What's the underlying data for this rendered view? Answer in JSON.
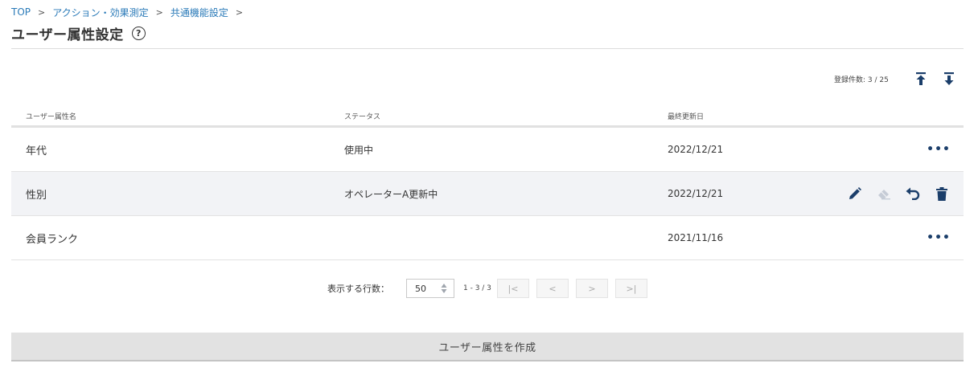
{
  "breadcrumb": [
    {
      "label": "TOP"
    },
    {
      "label": "アクション・効果測定"
    },
    {
      "label": "共通機能設定"
    }
  ],
  "breadcrumb_separator": ">",
  "page": {
    "title": "ユーザー属性設定",
    "help_icon": "?"
  },
  "summary": {
    "count_text": "登録件数: 3 / 25"
  },
  "toolbar": {
    "upload_icon": "upload-arrow-icon",
    "download_icon": "download-arrow-icon"
  },
  "table": {
    "columns": [
      "ユーザー属性名",
      "ステータス",
      "最終更新日"
    ],
    "rows": [
      {
        "name": "年代",
        "status": "使用中",
        "date": "2022/12/21",
        "more": "•••"
      },
      {
        "name": "性別",
        "status": "オペレーターA更新中",
        "date": "2022/12/21"
      },
      {
        "name": "会員ランク",
        "status": "",
        "date": "2021/11/16",
        "more": "•••"
      }
    ]
  },
  "pagination": {
    "rows_label": "表示する行数：",
    "rows_value": "50",
    "range_text": "1 - 3 / 3",
    "first": "|<",
    "prev": "<",
    "next": ">",
    "last": ">|"
  },
  "create_button": {
    "label": "ユーザー属性を作成"
  },
  "colors": {
    "link": "#2a7ab8",
    "icon_navy": "#1b3e6a",
    "hover_row": "#f2f3f6",
    "button_bg": "#e2e2e2"
  }
}
